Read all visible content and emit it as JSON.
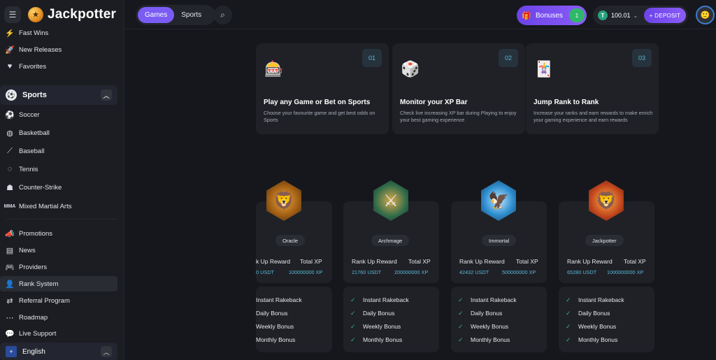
{
  "brand": {
    "name": "Jackpotter"
  },
  "sidebar": {
    "top_items": [
      {
        "label": "Fast Wins",
        "icon": "bolt-icon"
      },
      {
        "label": "New Releases",
        "icon": "rocket-icon"
      },
      {
        "label": "Favorites",
        "icon": "heart-icon"
      }
    ],
    "sports_header": "Sports",
    "sports_items": [
      {
        "label": "Soccer",
        "icon": "soccer-ball-icon"
      },
      {
        "label": "Basketball",
        "icon": "basketball-icon"
      },
      {
        "label": "Baseball",
        "icon": "baseball-bat-icon"
      },
      {
        "label": "Tennis",
        "icon": "tennis-icon"
      },
      {
        "label": "Counter-Strike",
        "icon": "counter-strike-icon"
      },
      {
        "label": "Mixed Martial Arts",
        "icon": "mma-icon"
      }
    ],
    "more_items": [
      {
        "label": "Promotions",
        "icon": "megaphone-icon"
      },
      {
        "label": "News",
        "icon": "news-icon"
      },
      {
        "label": "Providers",
        "icon": "gamepad-icon"
      },
      {
        "label": "Rank System",
        "icon": "user-icon"
      },
      {
        "label": "Referral Program",
        "icon": "share-icon"
      },
      {
        "label": "Roadmap",
        "icon": "roadmap-icon"
      },
      {
        "label": "Live Support",
        "icon": "chat-icon"
      }
    ],
    "language": "English"
  },
  "topbar": {
    "tabs": [
      "Games",
      "Sports"
    ],
    "bonuses_label": "Bonuses",
    "bonuses_count": "1",
    "balance": "100.01",
    "deposit_label": "+ DEPOSIT"
  },
  "steps": [
    {
      "num": "01",
      "title": "Play any Game or Bet on Sports",
      "desc": "Choose your favourite game and get best odds on Sports",
      "icon": "slot-machine-icon"
    },
    {
      "num": "02",
      "title": "Monitor your XP Bar",
      "desc": "Check live increasing XP bar during Playing to enjoy your best gaming experience",
      "icon": "dice-icon"
    },
    {
      "num": "03",
      "title": "Jump Rank to Rank",
      "desc": "Increase your ranks and earn rewards to make enrich your gaming experience and earn rewards",
      "icon": "poker-table-icon"
    }
  ],
  "ranks": [
    {
      "name": "Oracle",
      "reward_label": "k Up Reward",
      "total_label": "Total XP",
      "reward": "0 USDT",
      "total": "100000000 XP"
    },
    {
      "name": "Archmage",
      "reward_label": "Rank Up Reward",
      "total_label": "Total XP",
      "reward": "21760 USDT",
      "total": "200000000 XP"
    },
    {
      "name": "Immortal",
      "reward_label": "Rank Up Reward",
      "total_label": "Total XP",
      "reward": "42432 USDT",
      "total": "500000000 XP"
    },
    {
      "name": "Jackpotter",
      "reward_label": "Rank Up Reward",
      "total_label": "Total XP",
      "reward": "65280 USDT",
      "total": "1000000000 XP"
    }
  ],
  "perks": [
    "Instant Rakeback",
    "Daily Bonus",
    "Weekly Bonus",
    "Monthly Bonus"
  ],
  "colors": {
    "accent": "#7a5cf5",
    "success": "#2fb86a",
    "value": "#5bb8d6"
  }
}
